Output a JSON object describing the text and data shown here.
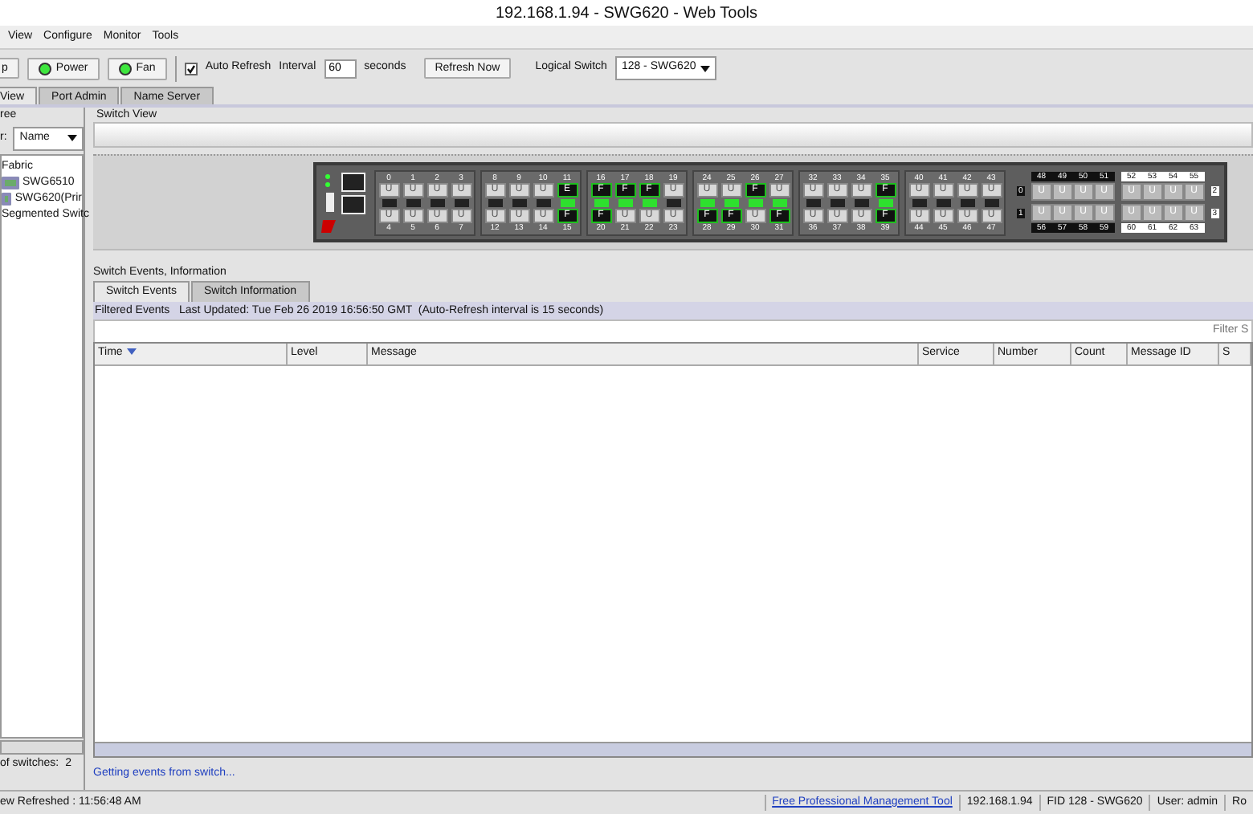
{
  "window": {
    "title": "192.168.1.94 - SWG620 - Web Tools"
  },
  "menu": [
    "View",
    "Configure",
    "Monitor",
    "Tools"
  ],
  "toolbar": {
    "status_buttons": [
      {
        "label": "p",
        "led": false
      },
      {
        "label": "Power",
        "led": true
      },
      {
        "label": "Fan",
        "led": true
      }
    ],
    "auto_refresh": {
      "label": "Auto Refresh",
      "checked": true
    },
    "interval_label": "Interval",
    "interval_value": "60",
    "seconds_label": "seconds",
    "refresh_button": "Refresh Now",
    "logical_switch_label": "Logical Switch",
    "logical_switch_value": "128 - SWG620"
  },
  "tabs": [
    {
      "label": "View",
      "selected": true
    },
    {
      "label": "Port Admin",
      "selected": false
    },
    {
      "label": "Name Server",
      "selected": false
    }
  ],
  "sidebar": {
    "title": "ree",
    "sort_label": "r:",
    "sort_value": "Name",
    "tree": [
      {
        "label": "Fabric",
        "children": [
          {
            "label": "SWG6510"
          },
          {
            "label": "SWG620(Prir"
          }
        ]
      },
      {
        "label": "Segmented Switc"
      }
    ],
    "count_label": "of switches:",
    "count_value": "2"
  },
  "switch_view": {
    "title": "Switch View",
    "port_groups": [
      {
        "top": [
          {
            "number": "0",
            "label": "U",
            "active": false
          },
          {
            "number": "1",
            "label": "U",
            "active": false
          },
          {
            "number": "2",
            "label": "U",
            "active": false
          },
          {
            "number": "3",
            "label": "U",
            "active": false
          }
        ],
        "bottom": [
          {
            "number": "4",
            "label": "U",
            "active": false
          },
          {
            "number": "5",
            "label": "U",
            "active": false
          },
          {
            "number": "6",
            "label": "U",
            "active": false
          },
          {
            "number": "7",
            "label": "U",
            "active": false
          }
        ]
      },
      {
        "top": [
          {
            "number": "8",
            "label": "U",
            "active": false
          },
          {
            "number": "9",
            "label": "U",
            "active": false
          },
          {
            "number": "10",
            "label": "U",
            "active": false
          },
          {
            "number": "11",
            "label": "E",
            "active": true
          }
        ],
        "bottom": [
          {
            "number": "12",
            "label": "U",
            "active": false
          },
          {
            "number": "13",
            "label": "U",
            "active": false
          },
          {
            "number": "14",
            "label": "U",
            "active": false
          },
          {
            "number": "15",
            "label": "F",
            "active": true
          }
        ]
      },
      {
        "top": [
          {
            "number": "16",
            "label": "F",
            "active": true
          },
          {
            "number": "17",
            "label": "F",
            "active": true
          },
          {
            "number": "18",
            "label": "F",
            "active": true
          },
          {
            "number": "19",
            "label": "U",
            "active": false
          }
        ],
        "bottom": [
          {
            "number": "20",
            "label": "F",
            "active": true
          },
          {
            "number": "21",
            "label": "U",
            "active": false
          },
          {
            "number": "22",
            "label": "U",
            "active": false
          },
          {
            "number": "23",
            "label": "U",
            "active": false
          }
        ]
      },
      {
        "top": [
          {
            "number": "24",
            "label": "U",
            "active": false
          },
          {
            "number": "25",
            "label": "U",
            "active": false
          },
          {
            "number": "26",
            "label": "F",
            "active": true
          },
          {
            "number": "27",
            "label": "U",
            "active": false
          }
        ],
        "bottom": [
          {
            "number": "28",
            "label": "F",
            "active": true
          },
          {
            "number": "29",
            "label": "F",
            "active": true
          },
          {
            "number": "30",
            "label": "U",
            "active": false
          },
          {
            "number": "31",
            "label": "F",
            "active": true
          }
        ]
      },
      {
        "top": [
          {
            "number": "32",
            "label": "U",
            "active": false
          },
          {
            "number": "33",
            "label": "U",
            "active": false
          },
          {
            "number": "34",
            "label": "U",
            "active": false
          },
          {
            "number": "35",
            "label": "F",
            "active": true
          }
        ],
        "bottom": [
          {
            "number": "36",
            "label": "U",
            "active": false
          },
          {
            "number": "37",
            "label": "U",
            "active": false
          },
          {
            "number": "38",
            "label": "U",
            "active": false
          },
          {
            "number": "39",
            "label": "F",
            "active": true
          }
        ]
      },
      {
        "top": [
          {
            "number": "40",
            "label": "U",
            "active": false
          },
          {
            "number": "41",
            "label": "U",
            "active": false
          },
          {
            "number": "42",
            "label": "U",
            "active": false
          },
          {
            "number": "43",
            "label": "U",
            "active": false
          }
        ],
        "bottom": [
          {
            "number": "44",
            "label": "U",
            "active": false
          },
          {
            "number": "45",
            "label": "U",
            "active": false
          },
          {
            "number": "46",
            "label": "U",
            "active": false
          },
          {
            "number": "47",
            "label": "U",
            "active": false
          }
        ]
      }
    ],
    "module": {
      "left_labels": [
        "0",
        "1"
      ],
      "right_labels": [
        "2",
        "3"
      ],
      "banks": [
        {
          "kind": "dark",
          "top": [
            {
              "number": "48",
              "label": "U"
            },
            {
              "number": "49",
              "label": "U"
            },
            {
              "number": "50",
              "label": "U"
            },
            {
              "number": "51",
              "label": "U"
            }
          ],
          "bottom": [
            {
              "number": "56",
              "label": "U"
            },
            {
              "number": "57",
              "label": "U"
            },
            {
              "number": "58",
              "label": "U"
            },
            {
              "number": "59",
              "label": "U"
            }
          ]
        },
        {
          "kind": "light",
          "top": [
            {
              "number": "52",
              "label": "U"
            },
            {
              "number": "53",
              "label": "U"
            },
            {
              "number": "54",
              "label": "U"
            },
            {
              "number": "55",
              "label": "U"
            }
          ],
          "bottom": [
            {
              "number": "60",
              "label": "U"
            },
            {
              "number": "61",
              "label": "U"
            },
            {
              "number": "62",
              "label": "U"
            },
            {
              "number": "63",
              "label": "U"
            }
          ]
        }
      ]
    }
  },
  "events": {
    "title": "Switch Events, Information",
    "tabs": [
      {
        "label": "Switch Events",
        "selected": true
      },
      {
        "label": "Switch Information",
        "selected": false
      }
    ],
    "filter_info": "Filtered Events   Last Updated: Tue Feb 26 2019 16:56:50 GMT  (Auto-Refresh interval is 15 seconds)",
    "filter_placeholder": "Filter S",
    "table": {
      "columns": [
        {
          "label": "Time",
          "sorted": true
        },
        {
          "label": "Level",
          "sorted": false
        },
        {
          "label": "Message",
          "sorted": false
        },
        {
          "label": "Service",
          "sorted": false
        },
        {
          "label": "Number",
          "sorted": false
        },
        {
          "label": "Count",
          "sorted": false
        },
        {
          "label": "Message ID",
          "sorted": false
        },
        {
          "label": "S",
          "sorted": false
        }
      ]
    },
    "status_link": "Getting events from switch..."
  },
  "status_bar": {
    "left": "ew Refreshed : 11:56:48 AM",
    "link": "Free Professional Management Tool",
    "fields": [
      "192.168.1.94",
      "FID 128 - SWG620",
      "User: admin",
      "Ro"
    ]
  }
}
